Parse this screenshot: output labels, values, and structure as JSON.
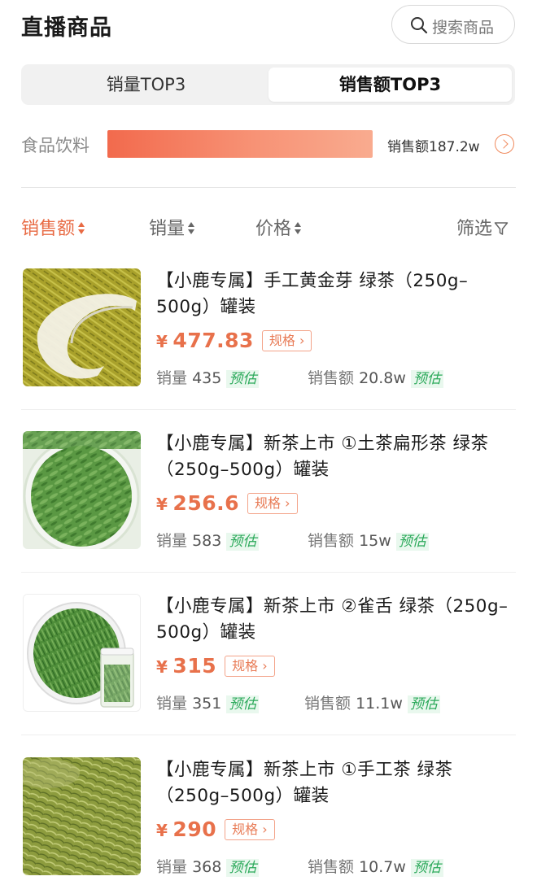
{
  "header": {
    "title": "直播商品",
    "search_placeholder": "搜索商品"
  },
  "tabs": [
    {
      "label": "销量TOP3",
      "active": false
    },
    {
      "label": "销售额TOP3",
      "active": true
    }
  ],
  "category": {
    "label": "食品饮料",
    "share": 1.0,
    "value_label": "销售额187.2w"
  },
  "sort": {
    "items": [
      {
        "label": "销售额",
        "active": true
      },
      {
        "label": "销量",
        "active": false
      },
      {
        "label": "价格",
        "active": false
      }
    ],
    "filter_label": "筛选"
  },
  "products": [
    {
      "name": "【小鹿专属】手工黄金芽 绿茶（250g–500g）罐装",
      "currency": "¥",
      "price": "477.83",
      "spec_label": "规格",
      "sales_label": "销量",
      "sales": "435",
      "estimate_label": "预估",
      "revenue_label": "销售额",
      "revenue": "20.8w"
    },
    {
      "name": "【小鹿专属】新茶上市 ①土茶扁形茶 绿茶（250g–500g）罐装",
      "currency": "¥",
      "price": "256.6",
      "spec_label": "规格",
      "sales_label": "销量",
      "sales": "583",
      "estimate_label": "预估",
      "revenue_label": "销售额",
      "revenue": "15w"
    },
    {
      "name": "【小鹿专属】新茶上市 ②雀舌 绿茶（250g–500g）罐装",
      "currency": "¥",
      "price": "315",
      "spec_label": "规格",
      "sales_label": "销量",
      "sales": "351",
      "estimate_label": "预估",
      "revenue_label": "销售额",
      "revenue": "11.1w"
    },
    {
      "name": "【小鹿专属】新茶上市 ①手工茶 绿茶（250g–500g）罐装",
      "currency": "¥",
      "price": "290",
      "spec_label": "规格",
      "sales_label": "销量",
      "sales": "368",
      "estimate_label": "预估",
      "revenue_label": "销售额",
      "revenue": "10.7w"
    }
  ],
  "colors": {
    "accent": "#e8714b",
    "estimate_green": "#2ba95a",
    "tea_gold": "#a8a32a",
    "tea_green": "#5d9a45"
  }
}
